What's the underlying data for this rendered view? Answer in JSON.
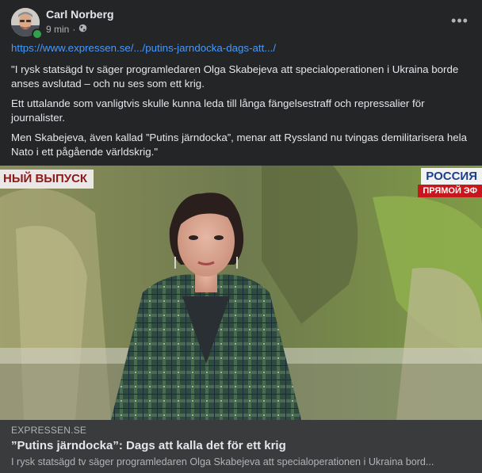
{
  "post": {
    "author": "Carl Norberg",
    "time": "9 min",
    "separator": "·",
    "audience_icon": "globe-icon",
    "more_label": "•••",
    "link_url": "https://www.expressen.se/.../putins-jarndocka-dags-att.../",
    "paragraphs": [
      "\"I rysk statsägd tv säger programledaren Olga Skabejeva att specialoperationen i Ukraina borde anses avslutad – och nu ses som ett krig.",
      "Ett uttalande som vanligtvis skulle kunna leda till långa fängelsestraff och repressalier för journalister.",
      "Men Skabejeva, även kallad ”Putins järndocka”, menar att Ryssland nu tvingas demilitarisera hela Nato i ett pågående världskrig.\""
    ]
  },
  "media": {
    "overlay_left": "НЫЙ ВЫПУСК",
    "overlay_right_top": "РОССИЯ",
    "overlay_right_bottom": "ПРЯМОЙ ЭФ"
  },
  "link_card": {
    "domain": "EXPRESSEN.SE",
    "title": "”Putins järndocka”: Dags att kalla det för ett krig",
    "description": "I rysk statsägd tv säger programledaren Olga Skabejeva att specialoperationen i Ukraina bord..."
  },
  "colors": {
    "background": "#242526",
    "link": "#4599ff",
    "online": "#31a24c",
    "card": "#3a3b3c"
  }
}
